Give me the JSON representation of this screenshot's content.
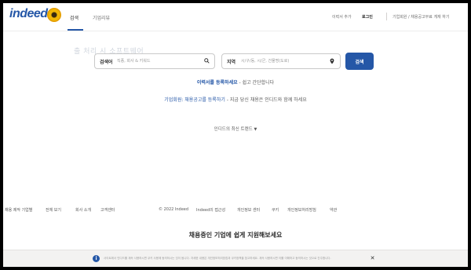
{
  "header": {
    "logo_text": "indeed",
    "tabs": [
      {
        "label": "검색"
      },
      {
        "label": "기업리뷰"
      }
    ],
    "links": {
      "resume": "이력서 추가",
      "login": "로그인",
      "employers": "기업회원 / 채용공고무료 게재 하기"
    }
  },
  "watermark": "출 처리 시 소프트웨어",
  "search": {
    "what_label": "검색어",
    "what_placeholder": "직종, 회사 & 키워드",
    "where_label": "지역",
    "where_placeholder": "시/구/동, 시/군, 건물명(도로)",
    "button_label": "검색"
  },
  "promo": {
    "resume_link": "이력서를 등록하세요",
    "resume_rest": " - 쉽고 간단합니다",
    "employer_link": "기업회원: 채용공고를 등록하기",
    "employer_rest": " - 지금 당신 채용은 인디드와 함께 하세요"
  },
  "trends": {
    "label": "인디드의 최신 트렌드"
  },
  "footer": {
    "left": [
      "채용 제작 기업별",
      "전체 보기",
      "회사 소개",
      "고객센터"
    ],
    "right": [
      "© 2022 Indeed",
      "Indeed의 접근성",
      "개인정보 센터",
      "쿠키",
      "개인정보처리방침",
      "약관"
    ]
  },
  "banner": {
    "title": "채용중인 기업에 쉽게 지원해보세요",
    "consent_text": "사이트에서 인디드를 계속 사용하시면 쿠키 사용에 동의하시는 것이 됩니다. 자세한 내용은 개인정보처리방침과 쿠키정책을 참고하세요. 계속 사용하시면 이를 이해하고 동의하시는 것으로 간주합니다."
  }
}
